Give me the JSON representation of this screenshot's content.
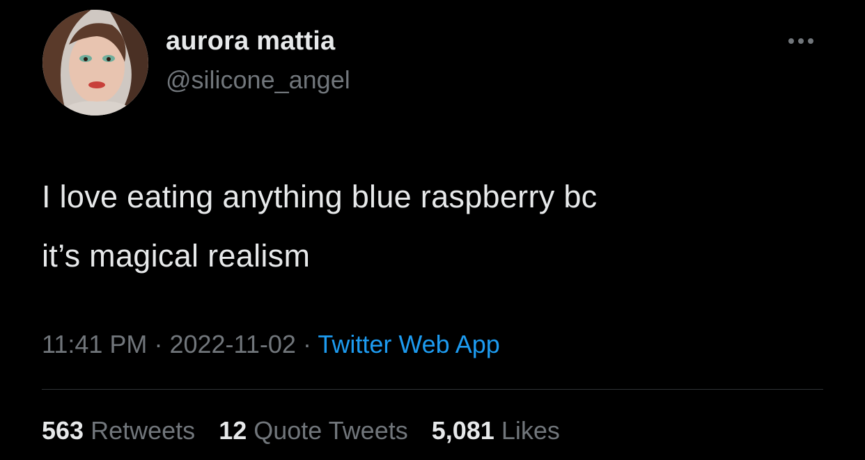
{
  "user": {
    "display_name": "aurora mattia",
    "handle": "@silicone_angel",
    "avatar_icon": "profile-photo"
  },
  "more_icon": "ellipsis-icon",
  "tweet": {
    "text": "I love eating anything blue raspberry bc\nit’s magical realism",
    "time": "11:41 PM",
    "date": "2022-11-02",
    "separator": "·",
    "source": "Twitter Web App"
  },
  "stats": {
    "retweets_count": "563",
    "retweets_label": "Retweets",
    "quotes_count": "12",
    "quotes_label": "Quote Tweets",
    "likes_count": "5,081",
    "likes_label": "Likes"
  },
  "colors": {
    "background": "#000000",
    "primary_text": "#e7e9ea",
    "secondary_text": "#71767b",
    "link": "#1d9bf0",
    "divider": "#2f3336"
  }
}
